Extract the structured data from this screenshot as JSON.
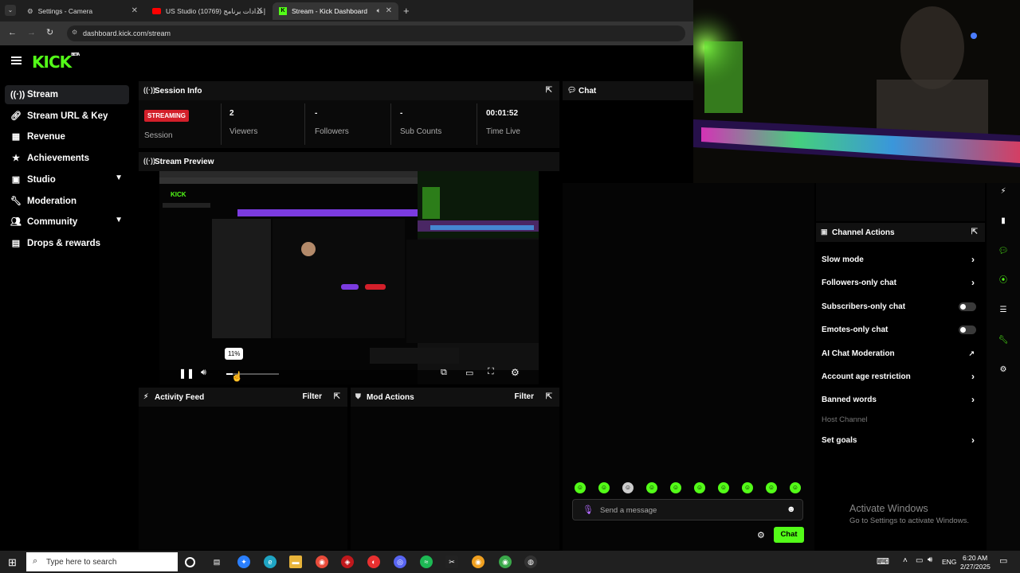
{
  "browser": {
    "tabs": [
      {
        "label": "Settings - Camera"
      },
      {
        "label": "US Studio إعدادات برنامج (10769)"
      },
      {
        "label": "Stream - Kick Dashboard"
      }
    ],
    "url": "dashboard.kick.com/stream"
  },
  "brand": {
    "logo": "KICK",
    "beta": "BETA",
    "accent": "#53fc18"
  },
  "sidebar": {
    "items": [
      {
        "label": "Stream",
        "icon": "broadcast-icon"
      },
      {
        "label": "Stream URL & Key",
        "icon": "link-icon"
      },
      {
        "label": "Revenue",
        "icon": "revenue-icon"
      },
      {
        "label": "Achievements",
        "icon": "trophy-icon"
      },
      {
        "label": "Studio",
        "icon": "studio-icon"
      },
      {
        "label": "Moderation",
        "icon": "wrench-icon"
      },
      {
        "label": "Community",
        "icon": "people-icon"
      },
      {
        "label": "Drops & rewards",
        "icon": "drops-icon"
      }
    ]
  },
  "session": {
    "title": "Session Info",
    "status": "STREAMING",
    "status_label": "Session",
    "viewers": "2",
    "viewers_label": "Viewers",
    "followers": "-",
    "followers_label": "Followers",
    "subs": "-",
    "subs_label": "Sub Counts",
    "time": "00:01:52",
    "time_label": "Time Live"
  },
  "preview": {
    "title": "Stream Preview",
    "volume_tooltip": "11%"
  },
  "activity": {
    "title": "Activity Feed",
    "filter": "Filter"
  },
  "mod_actions": {
    "title": "Mod Actions",
    "filter": "Filter"
  },
  "chat": {
    "title": "Chat",
    "placeholder": "Send a message",
    "send": "Chat"
  },
  "channel_actions": {
    "title": "Channel Actions",
    "rows": [
      {
        "label": "Slow mode"
      },
      {
        "label": "Followers-only chat"
      },
      {
        "label": "Subscribers-only chat"
      },
      {
        "label": "Emotes-only chat"
      },
      {
        "label": "AI Chat Moderation"
      },
      {
        "label": "Account age restriction"
      },
      {
        "label": "Banned words"
      },
      {
        "label": "Host Channel"
      },
      {
        "label": "Set goals"
      }
    ]
  },
  "watermark": {
    "line1": "Activate Windows",
    "line2": "Go to Settings to activate Windows."
  },
  "taskbar": {
    "search": "Type here to search",
    "lang": "ENG",
    "time": "6:20 AM",
    "date": "2/27/2025"
  }
}
